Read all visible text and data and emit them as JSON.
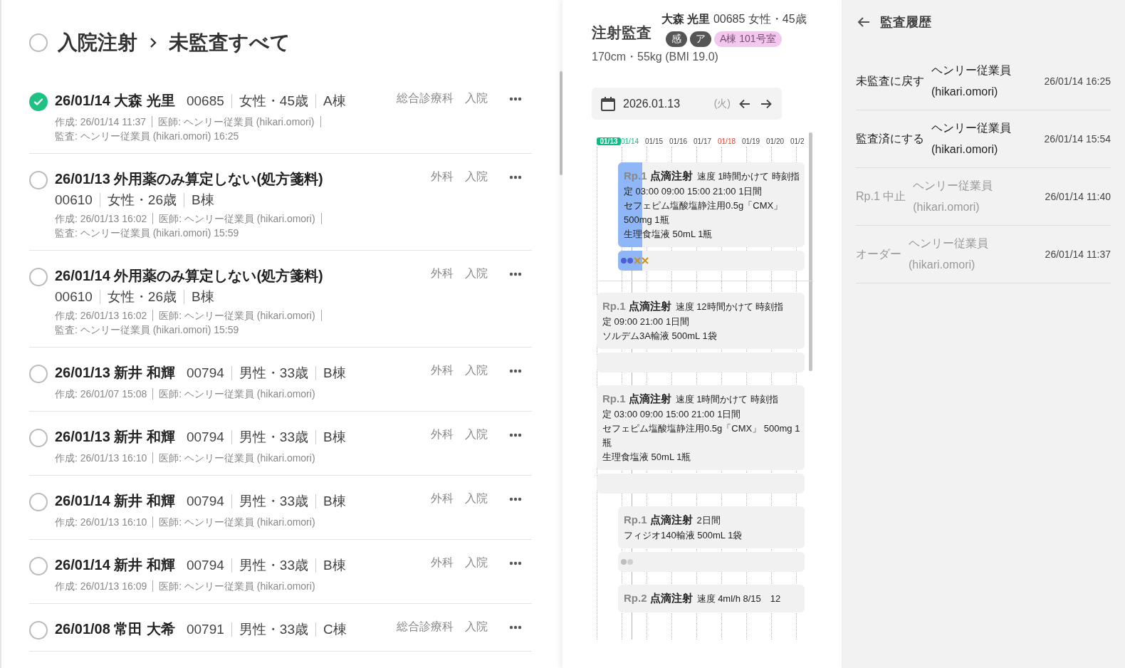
{
  "list": {
    "header": {
      "checked": false,
      "crumbs": [
        "入院注射",
        "未監査すべて"
      ]
    },
    "items": [
      {
        "checked": true,
        "title": "26/01/14 大森 光里",
        "patient_id": "00685",
        "sex_age": "女性・45歳",
        "ward": "A棟",
        "department": "総合診療科",
        "type": "入院",
        "meta": [
          "作成: 26/01/14 11:37",
          "医師: ヘンリー従業員 (hikari.omori)",
          "監査: ヘンリー従業員 (hikari.omori) 16:25"
        ]
      },
      {
        "checked": false,
        "title": "26/01/13 外用薬のみ算定しない(処方箋料)",
        "patient_id": "00610",
        "sex_age": "女性・26歳",
        "ward": "B棟",
        "department": "外科",
        "type": "入院",
        "meta": [
          "作成: 26/01/13 16:02",
          "医師: ヘンリー従業員 (hikari.omori)",
          "監査: ヘンリー従業員 (hikari.omori) 15:59"
        ]
      },
      {
        "checked": false,
        "title": "26/01/14 外用薬のみ算定しない(処方箋料)",
        "patient_id": "00610",
        "sex_age": "女性・26歳",
        "ward": "B棟",
        "department": "外科",
        "type": "入院",
        "meta": [
          "作成: 26/01/13 16:02",
          "医師: ヘンリー従業員 (hikari.omori)",
          "監査: ヘンリー従業員 (hikari.omori) 15:59"
        ]
      },
      {
        "checked": false,
        "title": "26/01/13 新井 和輝",
        "patient_id": "00794",
        "sex_age": "男性・33歳",
        "ward": "B棟",
        "department": "外科",
        "type": "入院",
        "meta": [
          "作成: 26/01/07 15:08",
          "医師: ヘンリー従業員 (hikari.omori)"
        ]
      },
      {
        "checked": false,
        "title": "26/01/13 新井 和輝",
        "patient_id": "00794",
        "sex_age": "男性・33歳",
        "ward": "B棟",
        "department": "外科",
        "type": "入院",
        "meta": [
          "作成: 26/01/13 16:10",
          "医師: ヘンリー従業員 (hikari.omori)"
        ]
      },
      {
        "checked": false,
        "title": "26/01/14 新井 和輝",
        "patient_id": "00794",
        "sex_age": "男性・33歳",
        "ward": "B棟",
        "department": "外科",
        "type": "入院",
        "meta": [
          "作成: 26/01/13 16:10",
          "医師: ヘンリー従業員 (hikari.omori)"
        ]
      },
      {
        "checked": false,
        "title": "26/01/14 新井 和輝",
        "patient_id": "00794",
        "sex_age": "男性・33歳",
        "ward": "B棟",
        "department": "外科",
        "type": "入院",
        "meta": [
          "作成: 26/01/13 16:09",
          "医師: ヘンリー従業員 (hikari.omori)"
        ]
      },
      {
        "checked": false,
        "title": "26/01/08 常田 大希",
        "patient_id": "00791",
        "sex_age": "男性・33歳",
        "ward": "C棟",
        "department": "総合診療科",
        "type": "入院"
      }
    ]
  },
  "audit": {
    "title": "注射監査",
    "patient": "**大森 光里** 00685 女性・45歳",
    "badges": [
      {
        "label": "感",
        "color": "#555555"
      },
      {
        "label": "ア",
        "color": "#555555"
      },
      {
        "label": "A棟 101号室",
        "color": "#f3c8ee"
      }
    ],
    "body": "170cm・55kg (BMI 19.0)",
    "date": "2026.01.13",
    "weekday": "(火)",
    "days": [
      {
        "label": "01/13",
        "kind": "selected"
      },
      {
        "label": "01/14",
        "kind": "today"
      },
      {
        "label": "01/15",
        "kind": "normal"
      },
      {
        "label": "01/16",
        "kind": "normal"
      },
      {
        "label": "01/17",
        "kind": "normal"
      },
      {
        "label": "01/18",
        "kind": "holiday"
      },
      {
        "label": "01/19",
        "kind": "normal"
      },
      {
        "label": "01/20",
        "kind": "normal"
      },
      {
        "label": "01/2",
        "kind": "normal"
      }
    ],
    "groups": [
      {
        "orders": [
          {
            "rp": "Rp.1",
            "name": "点滴注射",
            "detail": "速度 1時間かけて 時刻指",
            "schedule": "定 03:00 09:00 15:00 21:00 1日間",
            "drugs": [
              "セフェピム塩酸塩静注用0.5g「CMX」 500mg 1瓶",
              "生理食塩液 50mL 1瓶"
            ],
            "shifted": true,
            "level": 0.13,
            "marks": [
              {
                "kind": "dot",
                "color": "#4b5fd8"
              },
              {
                "kind": "dot",
                "color": "#4b5fd8"
              },
              {
                "kind": "cross",
                "color": "#c9921a"
              },
              {
                "kind": "cross",
                "color": "#c9921a"
              }
            ]
          }
        ]
      },
      {
        "orders": [
          {
            "rp": "Rp.1",
            "name": "点滴注射",
            "detail": "速度 12時間かけて 時刻指",
            "schedule": "定 09:00 21:00 1日間",
            "drugs": [
              "ソルデム3A輸液 500mL 1袋"
            ],
            "shifted": false,
            "level": 0
          },
          {
            "rp": "Rp.1",
            "name": "点滴注射",
            "detail": "速度 1時間かけて 時刻指",
            "schedule": "定 03:00 09:00 15:00 21:00 1日間",
            "drugs": [
              "セフェピム塩酸塩静注用0.5g「CMX」 500mg 1瓶",
              "生理食塩液 50mL 1瓶"
            ],
            "shifted": false,
            "level": 0
          },
          {
            "rp": "Rp.1",
            "name": "点滴注射",
            "detail": "2日間",
            "drugs": [
              "フィジオ140輸液 500mL 1袋"
            ],
            "shifted": true,
            "level": 0,
            "marks": [
              {
                "kind": "dot",
                "color": "#bdbdbd"
              },
              {
                "kind": "dot",
                "color": "#cfcfcf"
              }
            ]
          },
          {
            "rp": "Rp.2",
            "name": "点滴注射",
            "detail": "速度 4ml/h 8/15　12",
            "shifted": true,
            "level": 0
          }
        ]
      }
    ]
  },
  "history": {
    "title": "監査履歴",
    "rows": [
      {
        "action": "未監査に戻す",
        "user": "ヘンリー従業員 (hikari.omori)",
        "time": "26/01/14 16:25",
        "disabled": false
      },
      {
        "action": "監査済にする",
        "user": "ヘンリー従業員 (hikari.omori)",
        "time": "26/01/14 15:54",
        "disabled": false
      },
      {
        "action": "Rp.1 中止",
        "user": "ヘンリー従業員 (hikari.omori)",
        "time": "26/01/14 11:40",
        "disabled": true
      },
      {
        "action": "オーダー",
        "user": "ヘンリー従業員 (hikari.omori)",
        "time": "26/01/14 11:37",
        "disabled": true
      }
    ]
  }
}
